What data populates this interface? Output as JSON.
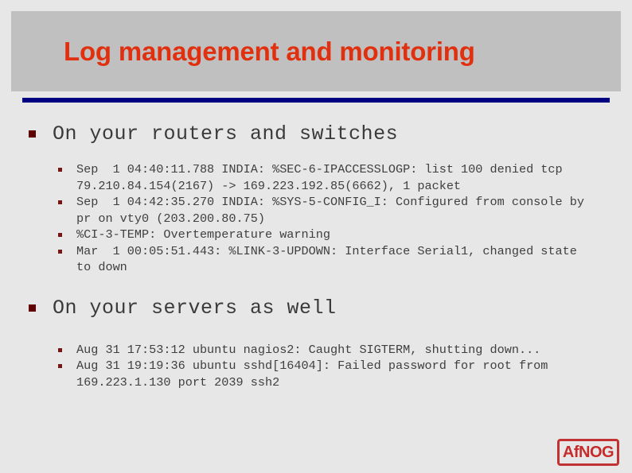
{
  "slide": {
    "title": "Log management and monitoring",
    "title_color": "#e0300f",
    "band_color": "#c0c0c0",
    "rule_color": "#000080",
    "background_color": "#e7e7e7"
  },
  "sections": [
    {
      "heading": "On your routers and switches",
      "entries": [
        "Sep  1 04:40:11.788 INDIA: %SEC-6-IPACCESSLOGP: list 100 denied tcp 79.210.84.154(2167) -> 169.223.192.85(6662), 1 packet",
        "Sep  1 04:42:35.270 INDIA: %SYS-5-CONFIG_I: Configured from console by pr on vty0 (203.200.80.75)",
        "%CI-3-TEMP: Overtemperature warning",
        "Mar  1 00:05:51.443: %LINK-3-UPDOWN: Interface Serial1, changed state to down"
      ]
    },
    {
      "heading": "On your servers as well",
      "entries": [
        "Aug 31 17:53:12 ubuntu nagios2: Caught SIGTERM, shutting down...",
        "Aug 31 19:19:36 ubuntu sshd[16404]: Failed password for root from 169.223.1.130 port 2039 ssh2"
      ]
    }
  ],
  "logo": {
    "text": "AfNOG",
    "color": "#c62a2a"
  }
}
